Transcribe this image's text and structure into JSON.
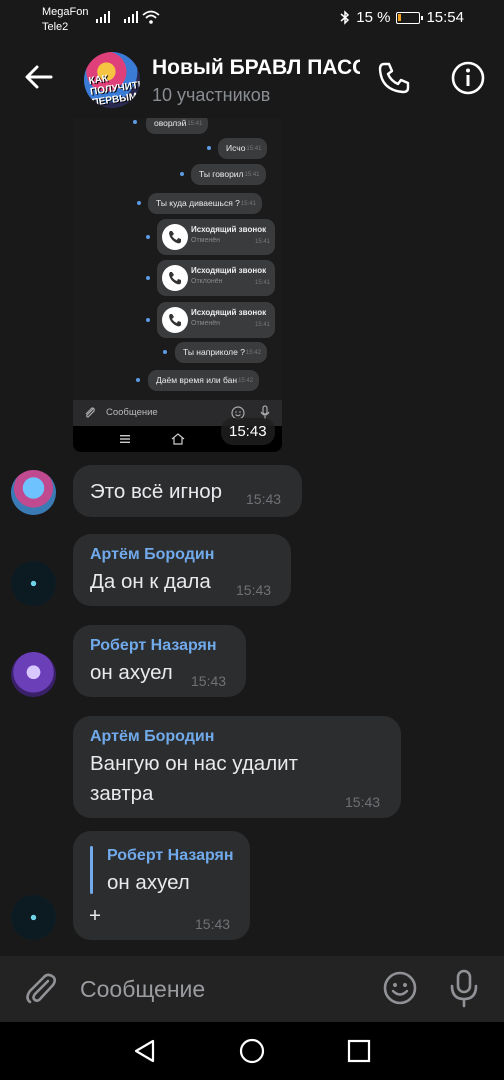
{
  "status_bar": {
    "carrier_1": "MegaFon",
    "carrier_2": "Tele2",
    "battery_text": "15 %",
    "battery_level": 0.15,
    "time": "15:54"
  },
  "header": {
    "title": "Новый БРАВЛ ПАСС",
    "subtitle": "10 участников",
    "avatar_text": "КАК ПОЛУЧИТЬ ПЕРВЫМ"
  },
  "embedded_screenshot": {
    "messages": [
      {
        "text": "оворлэй",
        "time": "15:41"
      },
      {
        "text": "Исчо",
        "time": "15:41"
      },
      {
        "text": "Ты говорил",
        "time": "15:41"
      },
      {
        "text": "Ты куда диваешься ?",
        "time": "15:41"
      },
      {
        "text": "Ты наприколе ?",
        "time": "15:42"
      },
      {
        "text": "Даём время или бан",
        "time": "15:42"
      }
    ],
    "calls": [
      {
        "title": "Исходящий звонок",
        "status": "Отменён",
        "time": "15:41"
      },
      {
        "title": "Исходящий звонок",
        "status": "Отклонён",
        "time": "15:41"
      },
      {
        "title": "Исходящий звонок",
        "status": "Отменён",
        "time": "15:41"
      }
    ],
    "input_placeholder": "Сообщение",
    "time": "15:43"
  },
  "messages": [
    {
      "author": "",
      "text": "Это всё игнор",
      "time": "15:43"
    },
    {
      "author": "Артём Бородин",
      "text": "Да он к дала",
      "time": "15:43"
    },
    {
      "author": "Роберт Назарян",
      "text": "он ахуел",
      "time": "15:43"
    },
    {
      "author": "Артём Бородин",
      "text_line1": "Вангую он нас удалит",
      "text_line2": "завтра",
      "time": "15:43"
    },
    {
      "reply_author": "Роберт Назарян",
      "reply_text": "он ахуел",
      "text": "+",
      "time": "15:43"
    }
  ],
  "composer": {
    "placeholder": "Сообщение"
  },
  "colors": {
    "background": "#19191a",
    "bubble": "#2c2d2e",
    "author": "#71aaeb",
    "timestamp": "#6f7175"
  }
}
